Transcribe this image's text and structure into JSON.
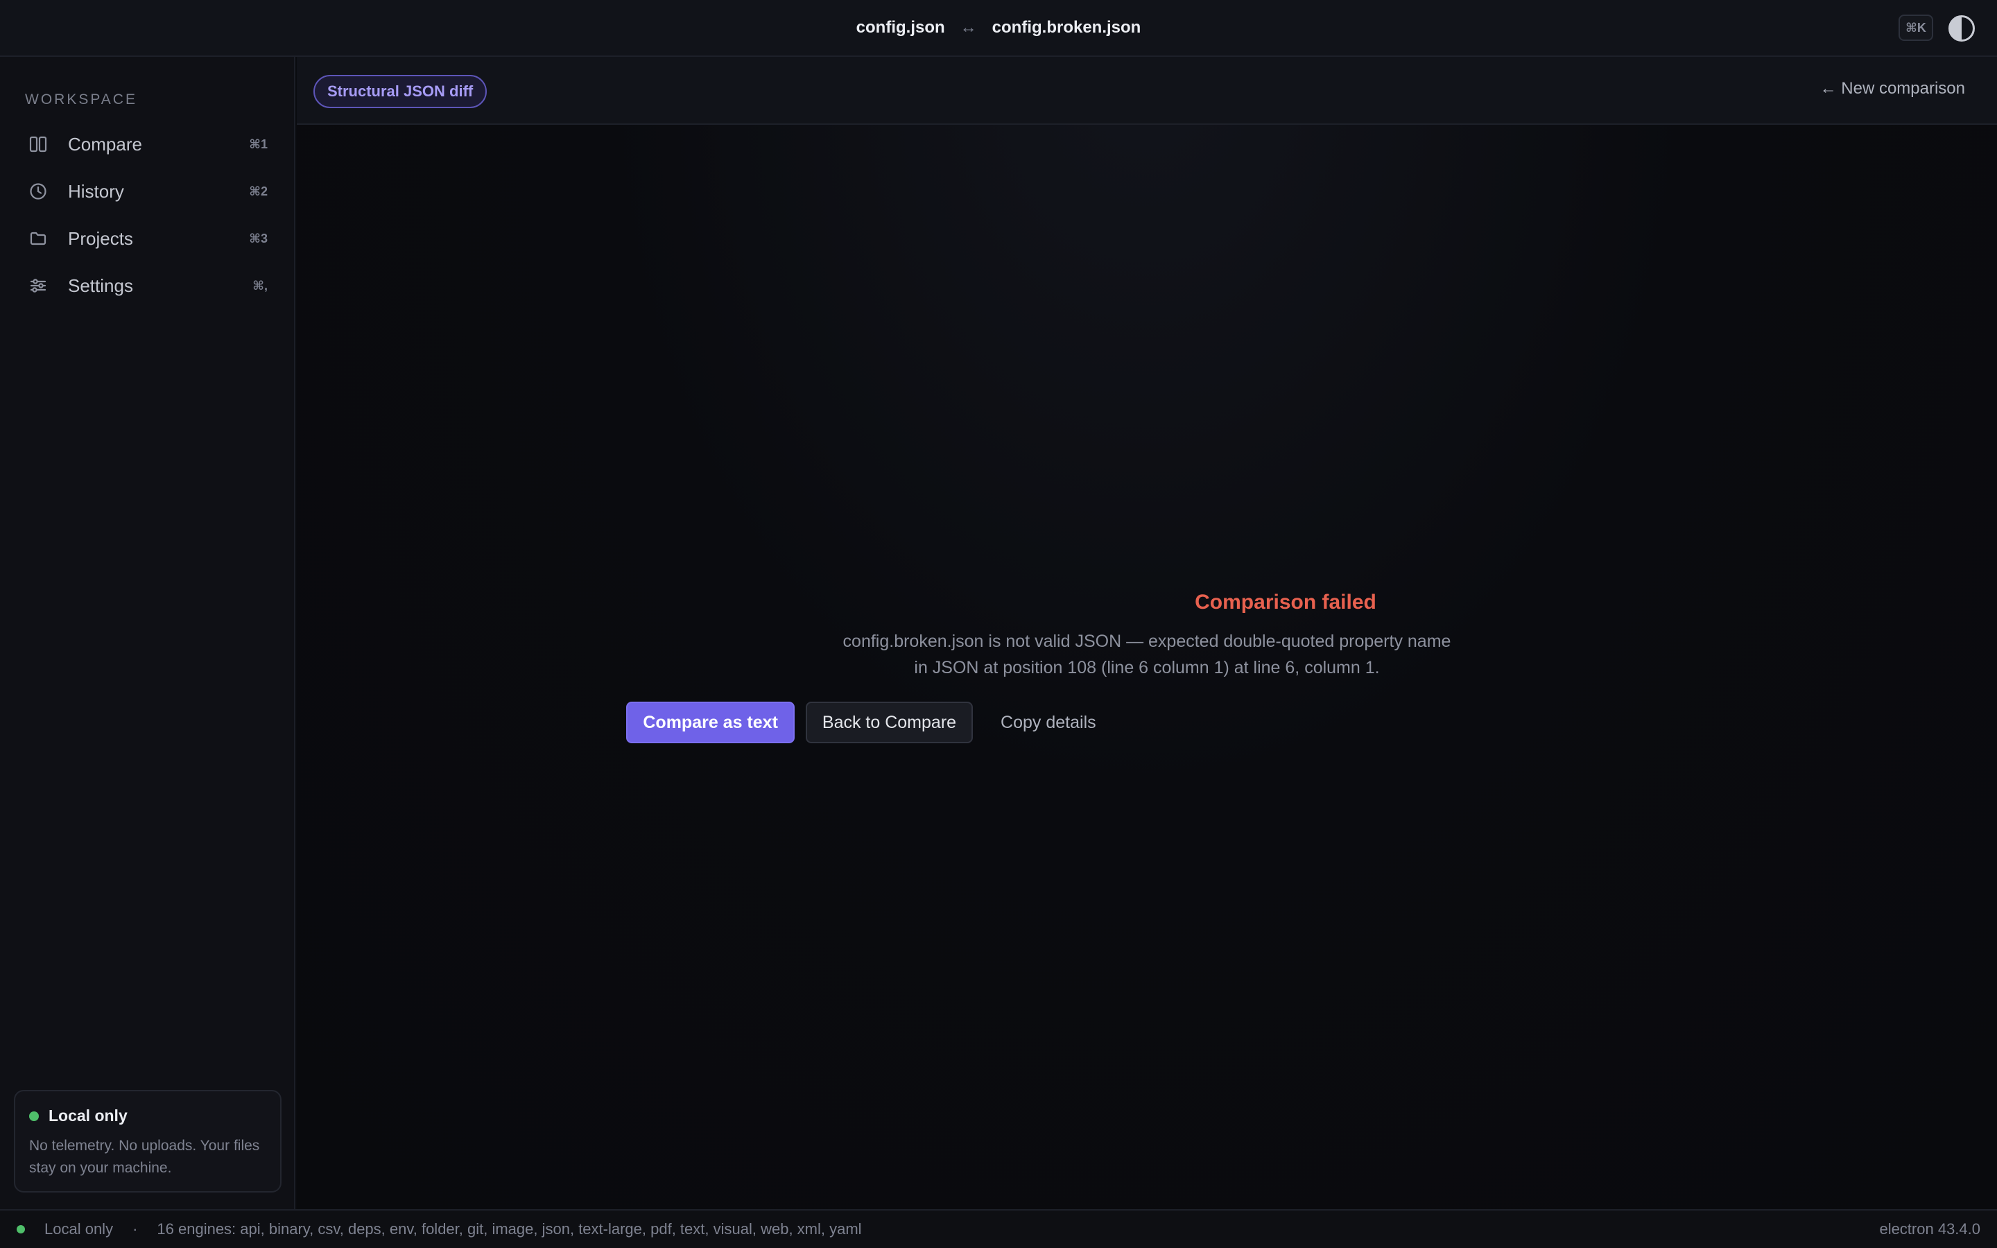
{
  "titlebar": {
    "left_file": "config.json",
    "arrow": "↔",
    "right_file": "config.broken.json",
    "command_key": "⌘K"
  },
  "sidebar": {
    "section_label": "WORKSPACE",
    "items": [
      {
        "label": "Compare",
        "shortcut": "⌘1",
        "icon": "columns-icon"
      },
      {
        "label": "History",
        "shortcut": "⌘2",
        "icon": "clock-icon"
      },
      {
        "label": "Projects",
        "shortcut": "⌘3",
        "icon": "folder-icon"
      },
      {
        "label": "Settings",
        "shortcut": "⌘,",
        "icon": "sliders-icon"
      }
    ],
    "local_card": {
      "title": "Local only",
      "text": "No telemetry. No uploads. Your files stay on your machine."
    }
  },
  "subbar": {
    "mode_pill": "Structural JSON diff",
    "new_comparison": "← New comparison"
  },
  "error": {
    "title": "Comparison failed",
    "message": "config.broken.json is not valid JSON — expected double-quoted property name in JSON at position 108 (line 6 column 1) at line 6, column 1.",
    "primary_action": "Compare as text",
    "secondary_action": "Back to Compare",
    "tertiary_action": "Copy details"
  },
  "statusbar": {
    "local": "Local only",
    "separator": "·",
    "engines": "16 engines: api, binary, csv, deps, env, folder, git, image, json, text-large, pdf, text, visual, web, xml, yaml",
    "version": "electron 43.4.0"
  },
  "colors": {
    "accent": "#6f62e8",
    "error": "#e8614f",
    "status_green": "#4fbf6a"
  }
}
